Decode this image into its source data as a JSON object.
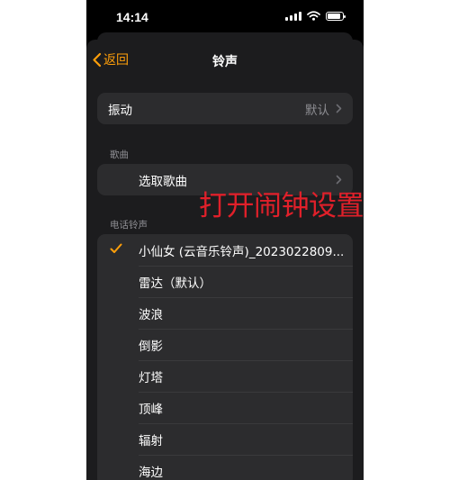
{
  "status_bar": {
    "time": "14:14",
    "battery_level": 0.85
  },
  "nav": {
    "back_label": "返回",
    "title": "铃声"
  },
  "vibration": {
    "label": "振动",
    "value": "默认"
  },
  "songs": {
    "header": "歌曲",
    "pick_label": "选取歌曲"
  },
  "ringtones": {
    "header": "电话铃声",
    "items": [
      {
        "label": "小仙女 (云音乐铃声)_2023022809...",
        "selected": true
      },
      {
        "label": "雷达（默认）",
        "selected": false
      },
      {
        "label": "波浪",
        "selected": false
      },
      {
        "label": "倒影",
        "selected": false
      },
      {
        "label": "灯塔",
        "selected": false
      },
      {
        "label": "顶峰",
        "selected": false
      },
      {
        "label": "辐射",
        "selected": false
      },
      {
        "label": "海边",
        "selected": false
      }
    ]
  },
  "overlay": {
    "caption": "打开闹钟设置铃声"
  },
  "colors": {
    "accent": "#ff9f0a",
    "overlay": "#e0202a",
    "background": "#1c1c1e",
    "cell": "#2c2c2e"
  }
}
